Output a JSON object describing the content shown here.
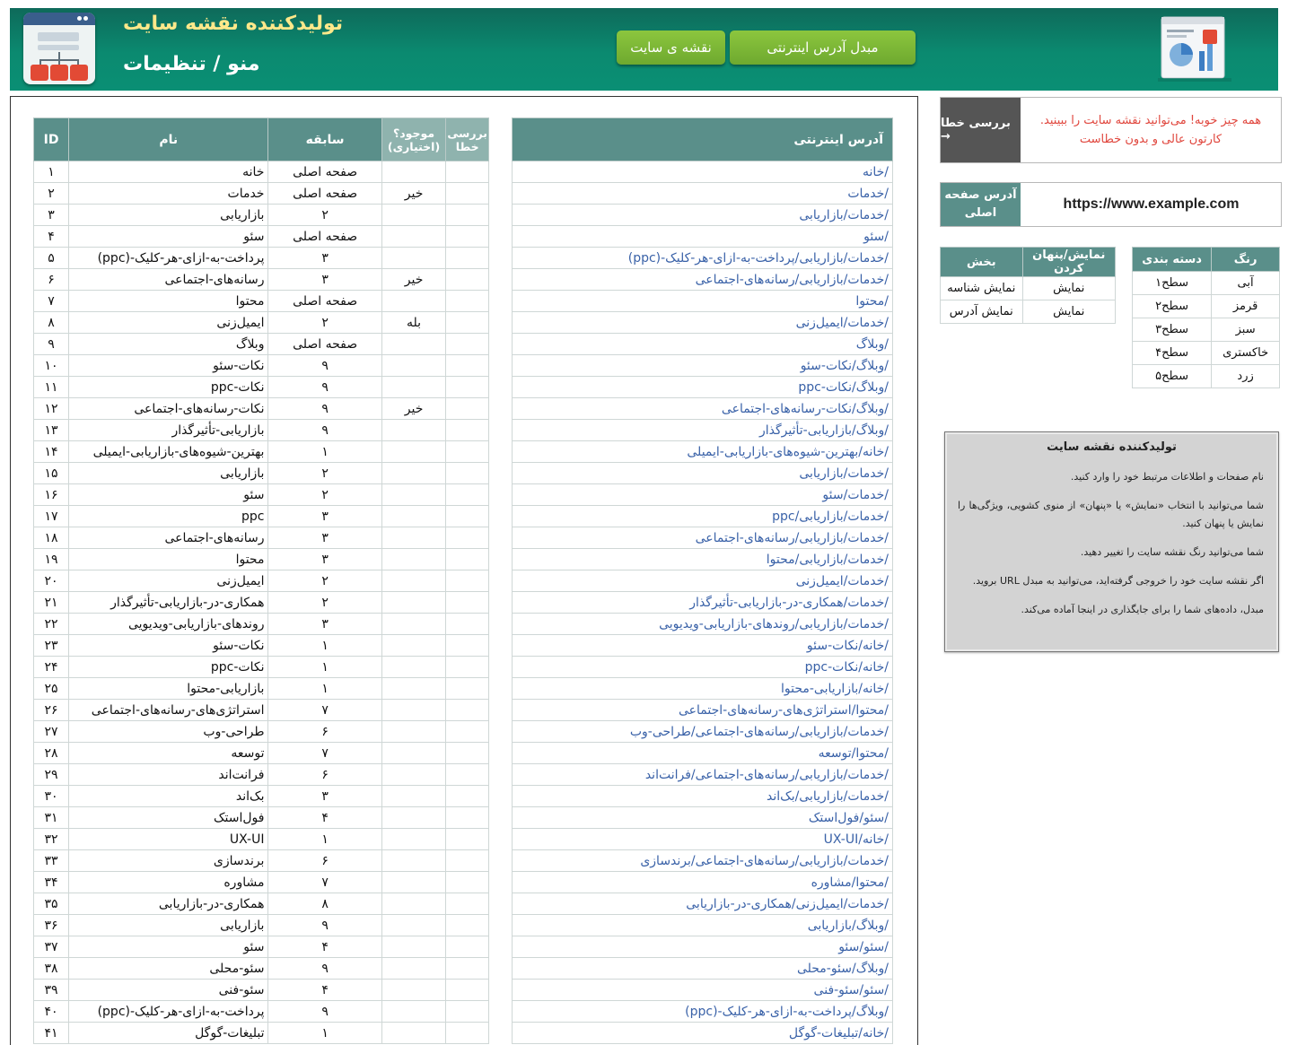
{
  "header": {
    "title": "تولیدکننده نقشه سایت",
    "subtitle": "منو / تنظیمات",
    "sitemap_button": "نقشه ی سایت",
    "url_converter_button": "مبدل آدرس اینترنتی"
  },
  "main_table": {
    "headers": {
      "id": "ID",
      "name": "نام",
      "previous": "سابقه",
      "exists": "موجود؟ (اختیاری)",
      "error_check": "بررسی خطا"
    },
    "rows": [
      {
        "id": "۱",
        "name": "خانه",
        "prev": "صفحه اصلی",
        "exists": ""
      },
      {
        "id": "۲",
        "name": "خدمات",
        "prev": "صفحه اصلی",
        "exists": "خیر"
      },
      {
        "id": "۳",
        "name": "بازاریابی",
        "prev": "۲",
        "exists": ""
      },
      {
        "id": "۴",
        "name": "سئو",
        "prev": "صفحه اصلی",
        "exists": ""
      },
      {
        "id": "۵",
        "name": "پرداخت-به-ازای-هر-کلیک-(ppc)",
        "prev": "۳",
        "exists": ""
      },
      {
        "id": "۶",
        "name": "رسانه‌های-اجتماعی",
        "prev": "۳",
        "exists": "خیر"
      },
      {
        "id": "۷",
        "name": "محتوا",
        "prev": "صفحه اصلی",
        "exists": ""
      },
      {
        "id": "۸",
        "name": "ایمیل‌زنی",
        "prev": "۲",
        "exists": "بله"
      },
      {
        "id": "۹",
        "name": "وبلاگ",
        "prev": "صفحه اصلی",
        "exists": ""
      },
      {
        "id": "۱۰",
        "name": "نکات-سئو",
        "prev": "۹",
        "exists": ""
      },
      {
        "id": "۱۱",
        "name": "نکات-ppc",
        "prev": "۹",
        "exists": ""
      },
      {
        "id": "۱۲",
        "name": "نکات-رسانه‌های-اجتماعی",
        "prev": "۹",
        "exists": "خیر"
      },
      {
        "id": "۱۳",
        "name": "بازاریابی-تأثیرگذار",
        "prev": "۹",
        "exists": ""
      },
      {
        "id": "۱۴",
        "name": "بهترین-شیوه‌های-بازاریابی-ایمیلی",
        "prev": "۱",
        "exists": ""
      },
      {
        "id": "۱۵",
        "name": "بازاریابی",
        "prev": "۲",
        "exists": ""
      },
      {
        "id": "۱۶",
        "name": "سئو",
        "prev": "۲",
        "exists": ""
      },
      {
        "id": "۱۷",
        "name": "ppc",
        "prev": "۳",
        "exists": ""
      },
      {
        "id": "۱۸",
        "name": "رسانه‌های-اجتماعی",
        "prev": "۳",
        "exists": ""
      },
      {
        "id": "۱۹",
        "name": "محتوا",
        "prev": "۳",
        "exists": ""
      },
      {
        "id": "۲۰",
        "name": "ایمیل‌زنی",
        "prev": "۲",
        "exists": ""
      },
      {
        "id": "۲۱",
        "name": "همکاری-در-بازاریابی-تأثیرگذار",
        "prev": "۲",
        "exists": ""
      },
      {
        "id": "۲۲",
        "name": "روندهای-بازاریابی-ویدیویی",
        "prev": "۳",
        "exists": ""
      },
      {
        "id": "۲۳",
        "name": "نکات-سئو",
        "prev": "۱",
        "exists": ""
      },
      {
        "id": "۲۴",
        "name": "نکات-ppc",
        "prev": "۱",
        "exists": ""
      },
      {
        "id": "۲۵",
        "name": "بازاریابی-محتوا",
        "prev": "۱",
        "exists": ""
      },
      {
        "id": "۲۶",
        "name": "استراتژی‌های-رسانه‌های-اجتماعی",
        "prev": "۷",
        "exists": ""
      },
      {
        "id": "۲۷",
        "name": "طراحی-وب",
        "prev": "۶",
        "exists": ""
      },
      {
        "id": "۲۸",
        "name": "توسعه",
        "prev": "۷",
        "exists": ""
      },
      {
        "id": "۲۹",
        "name": "فرانت‌اند",
        "prev": "۶",
        "exists": ""
      },
      {
        "id": "۳۰",
        "name": "بک‌اند",
        "prev": "۳",
        "exists": ""
      },
      {
        "id": "۳۱",
        "name": "فول‌استک",
        "prev": "۴",
        "exists": ""
      },
      {
        "id": "۳۲",
        "name": "UX-UI",
        "prev": "۱",
        "exists": ""
      },
      {
        "id": "۳۳",
        "name": "برندسازی",
        "prev": "۶",
        "exists": ""
      },
      {
        "id": "۳۴",
        "name": "مشاوره",
        "prev": "۷",
        "exists": ""
      },
      {
        "id": "۳۵",
        "name": "همکاری-در-بازاریابی",
        "prev": "۸",
        "exists": ""
      },
      {
        "id": "۳۶",
        "name": "بازاریابی",
        "prev": "۹",
        "exists": ""
      },
      {
        "id": "۳۷",
        "name": "سئو",
        "prev": "۴",
        "exists": ""
      },
      {
        "id": "۳۸",
        "name": "سئو-محلی",
        "prev": "۹",
        "exists": ""
      },
      {
        "id": "۳۹",
        "name": "سئو-فنی",
        "prev": "۴",
        "exists": ""
      },
      {
        "id": "۴۰",
        "name": "پرداخت-به-ازای-هر-کلیک-(ppc)",
        "prev": "۹",
        "exists": ""
      },
      {
        "id": "۴۱",
        "name": "تبلیغات-گوگل",
        "prev": "۱",
        "exists": ""
      }
    ]
  },
  "url_table": {
    "header": "آدرس اینترنتی",
    "rows": [
      "/خانه",
      "/خدمات",
      "/خدمات/بازاریابی",
      "/سئو",
      "/خدمات/بازاریابی/پرداخت-به-ازای-هر-کلیک-(ppc)",
      "/خدمات/بازاریابی/رسانه‌های-اجتماعی",
      "/محتوا",
      "/خدمات/ایمیل‌زنی",
      "/وبلاگ",
      "/وبلاگ/نکات-سئو",
      "/وبلاگ/نکات-ppc",
      "/وبلاگ/نکات-رسانه‌های-اجتماعی",
      "/وبلاگ/بازاریابی-تأثیرگذار",
      "/خانه/بهترین-شیوه‌های-بازاریابی-ایمیلی",
      "/خدمات/بازاریابی",
      "/خدمات/سئو",
      "/خدمات/بازاریابی/ppc",
      "/خدمات/بازاریابی/رسانه‌های-اجتماعی",
      "/خدمات/بازاریابی/محتوا",
      "/خدمات/ایمیل‌زنی",
      "/خدمات/همکاری-در-بازاریابی-تأثیرگذار",
      "/خدمات/بازاریابی/روندهای-بازاریابی-ویدیویی",
      "/خانه/نکات-سئو",
      "/خانه/نکات-ppc",
      "/خانه/بازاریابی-محتوا",
      "/محتوا/استراتژی‌های-رسانه‌های-اجتماعی",
      "/خدمات/بازاریابی/رسانه‌های-اجتماعی/طراحی-وب",
      "/محتوا/توسعه",
      "/خدمات/بازاریابی/رسانه‌های-اجتماعی/فرانت‌اند",
      "/خدمات/بازاریابی/بک‌اند",
      "/سئو/فول‌استک",
      "/خانه/UX-UI",
      "/خدمات/بازاریابی/رسانه‌های-اجتماعی/برندسازی",
      "/محتوا/مشاوره",
      "/خدمات/ایمیل‌زنی/همکاری-در-بازاریابی",
      "/وبلاگ/بازاریابی",
      "/سئو/سئو",
      "/وبلاگ/سئو-محلی",
      "/سئو/سئو-فنی",
      "/وبلاگ/پرداخت-به-ازای-هر-کلیک-(ppc)",
      "/خانه/تبلیغات-گوگل"
    ]
  },
  "error_check": {
    "button": "بررسی خطا →",
    "message_line1": "همه چیز خوبه! می‌توانید نقشه سایت را ببینید.",
    "message_line2": "کارتون عالی و بدون خطاست"
  },
  "homepage": {
    "label": "آدرس صفحه اصلی",
    "value": "https://www.example.com"
  },
  "show_table": {
    "headers": {
      "section": "بخش",
      "toggle": "نمایش/پنهان کردن"
    },
    "rows": [
      {
        "section": "نمایش شناسه",
        "toggle": "نمایش"
      },
      {
        "section": "نمایش آدرس",
        "toggle": "نمایش"
      }
    ]
  },
  "color_table": {
    "headers": {
      "color": "رنگ",
      "category": "دسته بندی"
    },
    "rows": [
      {
        "color": "آبی",
        "category": "سطح۱"
      },
      {
        "color": "قرمز",
        "category": "سطح۲"
      },
      {
        "color": "سبز",
        "category": "سطح۳"
      },
      {
        "color": "خاکستری",
        "category": "سطح۴"
      },
      {
        "color": "زرد",
        "category": "سطح۵"
      }
    ]
  },
  "info": {
    "title": "تولیدکننده نقشه سایت",
    "p1": "نام صفحات و اطلاعات مرتبط خود را وارد کنید.",
    "p2": "شما می‌توانید با انتخاب «نمایش» یا «پنهان» از منوی کشویی، ویژگی‌ها را نمایش یا پنهان کنید.",
    "p3": "شما می‌توانید رنگ نقشه سایت را تغییر دهید.",
    "p4": "اگر نقشه سایت خود را خروجی گرفته‌اید، می‌توانید به مبدل URL بروید.",
    "p5": "مبدل، داده‌های شما را برای جایگذاری در اینجا آماده می‌کند."
  },
  "colors": {
    "header_green": "#0b8a70",
    "table_header": "#5a8f8a",
    "button_green": "#7ab535",
    "error_red": "#e0463d",
    "link_blue": "#3a62a8"
  }
}
